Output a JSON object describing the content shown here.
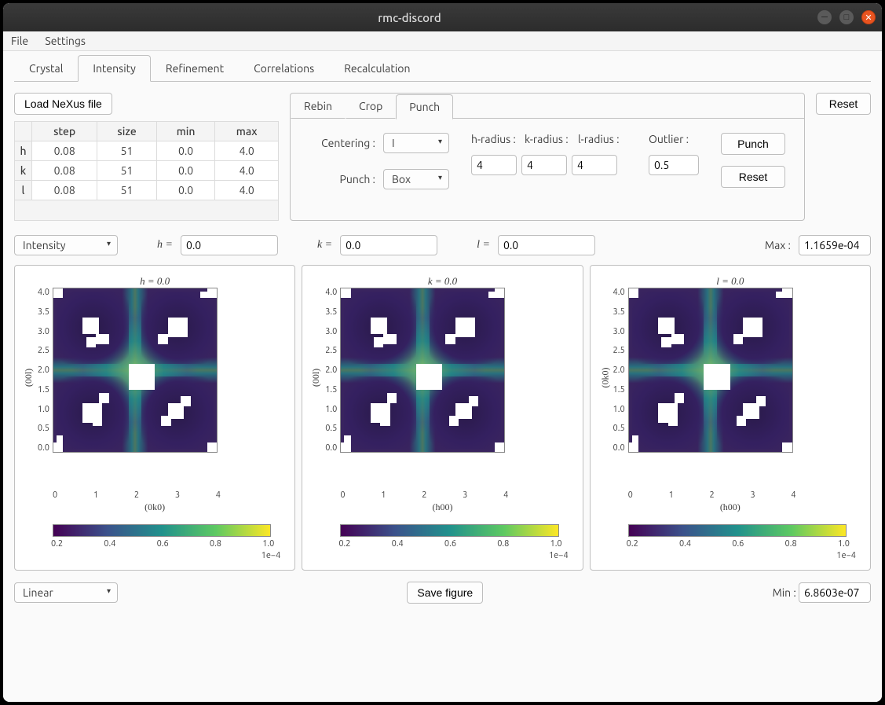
{
  "window": {
    "title": "rmc-discord"
  },
  "menu": {
    "file": "File",
    "settings": "Settings"
  },
  "main_tabs": [
    "Crystal",
    "Intensity",
    "Refinement",
    "Correlations",
    "Recalculation"
  ],
  "main_tab_active": 1,
  "load_btn": "Load NeXus file",
  "reset_btn": "Reset",
  "grid": {
    "headers": [
      "",
      "step",
      "size",
      "min",
      "max"
    ],
    "rows": [
      {
        "label": "h",
        "step": "0.08",
        "size": "51",
        "min": "0.0",
        "max": "4.0"
      },
      {
        "label": "k",
        "step": "0.08",
        "size": "51",
        "min": "0.0",
        "max": "4.0"
      },
      {
        "label": "l",
        "step": "0.08",
        "size": "51",
        "min": "0.0",
        "max": "4.0"
      }
    ]
  },
  "sub_tabs": [
    "Rebin",
    "Crop",
    "Punch"
  ],
  "sub_tab_active": 2,
  "punch": {
    "centering_label": "Centering :",
    "centering_value": "I",
    "punch_label": "Punch :",
    "punch_value": "Box",
    "radii_labels": [
      "h-radius :",
      "k-radius :",
      "l-radius :"
    ],
    "radii_values": [
      "4",
      "4",
      "4"
    ],
    "outlier_label": "Outlier :",
    "outlier_value": "0.5",
    "punch_btn": "Punch",
    "reset_btn": "Reset"
  },
  "view": {
    "mode": "Intensity",
    "h_label": "h =",
    "h_val": "0.0",
    "k_label": "k =",
    "k_val": "0.0",
    "l_label": "l =",
    "l_val": "0.0",
    "max_label": "Max :",
    "max_val": "1.1659e-04",
    "min_label": "Min :",
    "min_val": "6.8603e-07",
    "scale": "Linear",
    "save_fig": "Save figure"
  },
  "plots": [
    {
      "title": "h = 0.0",
      "ylabel": "(00l)",
      "xlabel": "(0k0)"
    },
    {
      "title": "k = 0.0",
      "ylabel": "(00l)",
      "xlabel": "(h00)"
    },
    {
      "title": "l = 0.0",
      "ylabel": "(0k0)",
      "xlabel": "(h00)"
    }
  ],
  "axis_ticks_y": [
    "4.0",
    "3.5",
    "3.0",
    "2.5",
    "2.0",
    "1.5",
    "1.0",
    "0.5",
    "0.0"
  ],
  "axis_ticks_x": [
    "0",
    "1",
    "2",
    "3",
    "4"
  ],
  "cbar_ticks": [
    "0.2",
    "0.4",
    "0.6",
    "0.8",
    "1.0"
  ],
  "cbar_exp": "1e−4",
  "chart_data": [
    {
      "type": "heatmap",
      "title": "h = 0.0",
      "xlabel": "(0k0)",
      "ylabel": "(00l)",
      "xlim": [
        0,
        4
      ],
      "ylim": [
        0,
        4
      ],
      "colormap": "viridis",
      "colorbar_range_scaled": [
        0.0,
        0.00011659
      ],
      "description": "Diffuse intensity slice at h=0; bright cross along k=2 and l=2 axes with brightest cluster at (2,2); four dark lobes near corners; symmetric white masked/punched regions at centre and around (~1,~1), (~1,~3), (~3,~1), (~3,~3); corners near (0,0) and (4,4) also masked."
    },
    {
      "type": "heatmap",
      "title": "k = 0.0",
      "xlabel": "(h00)",
      "ylabel": "(00l)",
      "xlim": [
        0,
        4
      ],
      "ylim": [
        0,
        4
      ],
      "colormap": "viridis",
      "colorbar_range_scaled": [
        0.0,
        0.00011659
      ],
      "description": "Same cross-shaped diffuse pattern as h-slice; visually identical masking pattern."
    },
    {
      "type": "heatmap",
      "title": "l = 0.0",
      "xlabel": "(h00)",
      "ylabel": "(0k0)",
      "xlim": [
        0,
        4
      ],
      "ylim": [
        0,
        4
      ],
      "colormap": "viridis",
      "colorbar_range_scaled": [
        0.0,
        0.00011659
      ],
      "description": "Same cross-shaped diffuse pattern; visually identical to other two slices."
    }
  ]
}
